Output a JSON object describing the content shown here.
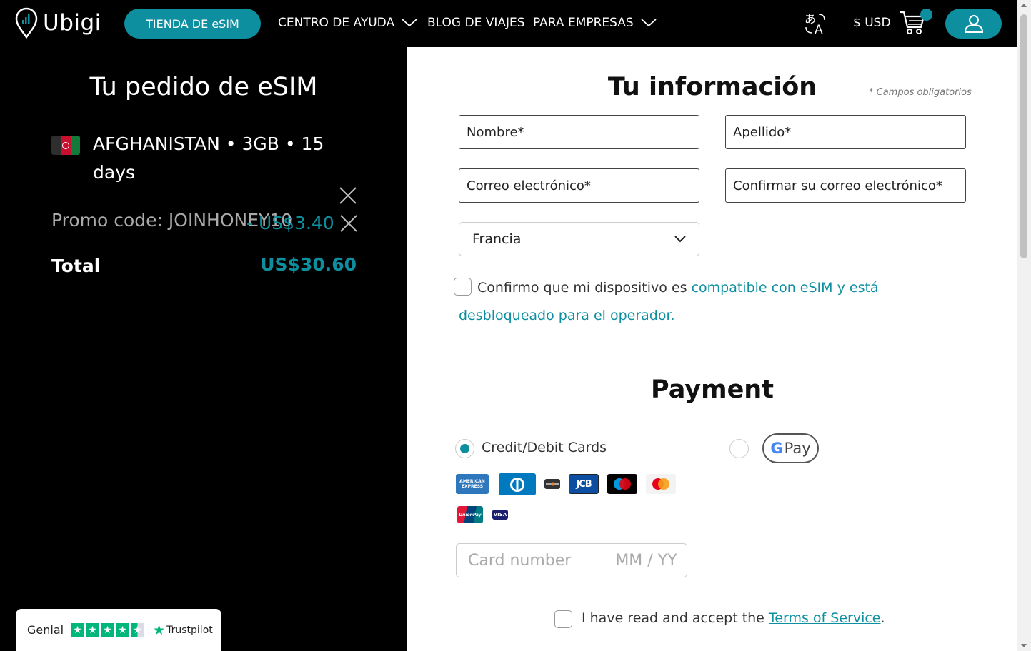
{
  "header": {
    "brand": "Ubigi",
    "store_button": "TIENDA DE eSIM",
    "nav": {
      "help": "CENTRO DE AYUDA",
      "blog": "BLOG DE VIAJES",
      "business": "PARA EMPRESAS"
    },
    "currency": "$ USD"
  },
  "order": {
    "title": "Tu pedido de eSIM",
    "product": "AFGHANISTAN • 3GB • 15 days",
    "promo_label": "Promo code: JOINHONEY10",
    "promo_discount": "- US$3.40",
    "total_label": "Total",
    "total_value": "US$30.60"
  },
  "trustpilot": {
    "rating_label": "Genial",
    "brand": "Trustpilot",
    "stars": 4.5
  },
  "info": {
    "title": "Tu información",
    "required_note": "* Campos obligatorios",
    "first_name_placeholder": "Nombre*",
    "last_name_placeholder": "Apellido*",
    "email_placeholder": "Correo electrónico*",
    "confirm_email_placeholder": "Confirmar su correo electrónico*",
    "country_value": "Francia",
    "confirm_text": "Confirmo que mi dispositivo es ",
    "confirm_link": "compatible con eSIM y está desbloqueado para el operador."
  },
  "payment": {
    "title": "Payment",
    "cards_label": "Credit/Debit Cards",
    "gpay_label": "Pay",
    "card_number_placeholder": "Card number",
    "expiry_placeholder": "MM / YY",
    "card_logos": {
      "amex": "AMERICAN EXPRESS",
      "jcb": "JCB",
      "unionpay": "UnionPay",
      "visa": "VISA"
    },
    "terms_text": "I have read and accept the ",
    "terms_link": "Terms of Service",
    "terms_end": "."
  },
  "colors": {
    "accent": "#0e8fa0",
    "trustpilot_green": "#00b67a"
  }
}
